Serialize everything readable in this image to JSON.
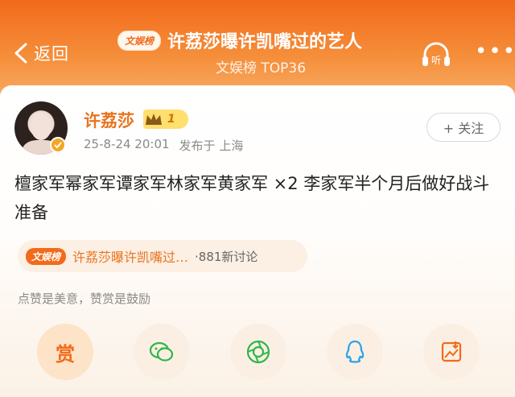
{
  "header": {
    "back_label": "返回",
    "badge": "文娱榜",
    "title": "许荔莎曝许凯嘴过的艺人",
    "subtitle": "文娱榜 TOP36",
    "listen_label": "听"
  },
  "post": {
    "username": "许荔莎",
    "level": "1",
    "date": "25-8-24 20:01",
    "location": "发布于 上海",
    "follow_label": "+ 关注",
    "content": "檀家军幂家军谭家军林家军黄家军 ×2 李家军半个月后做好战斗准备",
    "topic": {
      "badge": "文娱榜",
      "title": "许荔莎曝许凯嘴过…",
      "count": "·881新讨论"
    },
    "hint": "点赞是美意，赞赏是鼓励",
    "reward_label": "赏"
  },
  "colors": {
    "brand_orange": "#f26a1a",
    "username": "#e8741f"
  }
}
